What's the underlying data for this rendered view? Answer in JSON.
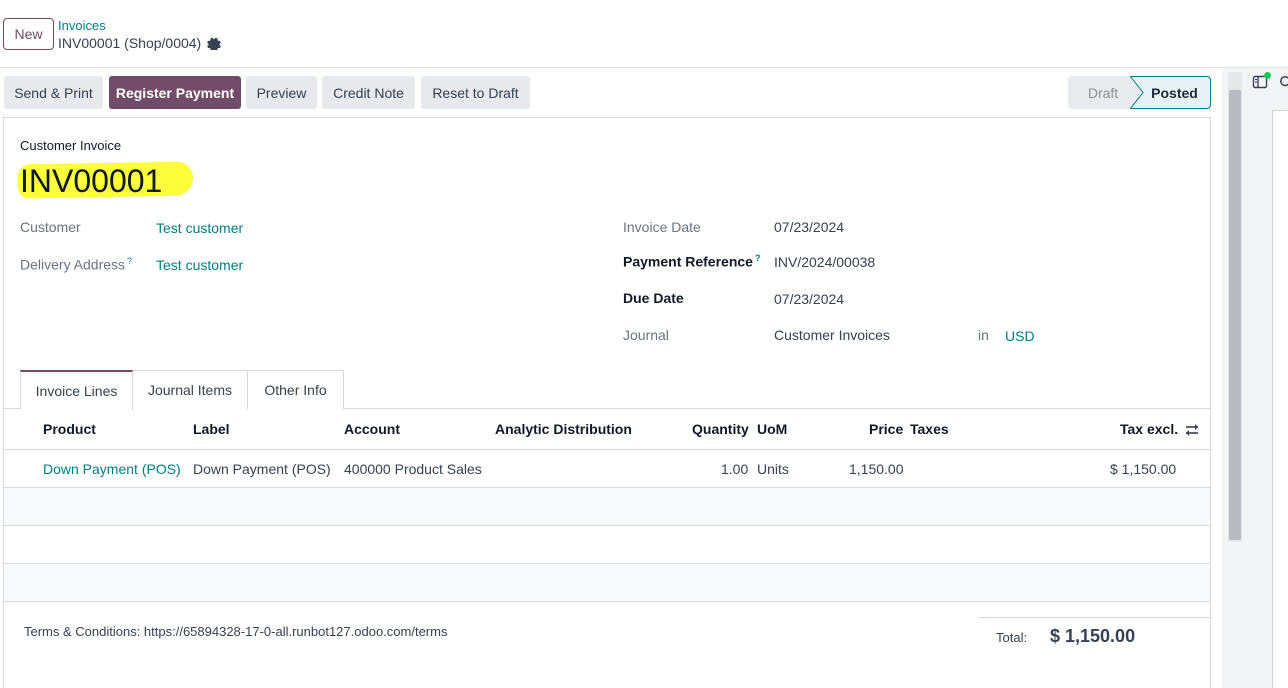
{
  "header": {
    "new_label": "New",
    "breadcrumb_parent": "Invoices",
    "breadcrumb_current": "INV00001 (Shop/0004)"
  },
  "actions": {
    "send_print": "Send & Print",
    "register_payment": "Register Payment",
    "preview": "Preview",
    "credit_note": "Credit Note",
    "reset_draft": "Reset to Draft"
  },
  "status": {
    "draft": "Draft",
    "posted": "Posted",
    "current": "Posted"
  },
  "doc": {
    "type": "Customer Invoice",
    "name": "INV00001"
  },
  "fields": {
    "customer_label": "Customer",
    "customer_value": "Test customer",
    "delivery_label": "Delivery Address",
    "delivery_value": "Test customer",
    "invoice_date_label": "Invoice Date",
    "invoice_date_value": "07/23/2024",
    "payment_ref_label": "Payment Reference",
    "payment_ref_value": "INV/2024/00038",
    "due_date_label": "Due Date",
    "due_date_value": "07/23/2024",
    "journal_label": "Journal",
    "journal_value": "Customer Invoices",
    "in_label": "in",
    "currency": "USD",
    "help_mark": "?"
  },
  "tabs": [
    "Invoice Lines",
    "Journal Items",
    "Other Info"
  ],
  "table": {
    "headers": {
      "product": "Product",
      "label": "Label",
      "account": "Account",
      "analytic": "Analytic Distribution",
      "quantity": "Quantity",
      "uom": "UoM",
      "price": "Price",
      "taxes": "Taxes",
      "tax_excl": "Tax excl."
    },
    "rows": [
      {
        "product": "Down Payment (POS)",
        "label": "Down Payment (POS)",
        "account": "400000 Product Sales",
        "analytic": "",
        "quantity": "1.00",
        "uom": "Units",
        "price": "1,150.00",
        "taxes": "",
        "tax_excl": "$ 1,150.00"
      }
    ]
  },
  "footer": {
    "terms": "Terms & Conditions: https://65894328-17-0-all.runbot127.odoo.com/terms",
    "total_label": "Total:",
    "total_value": "$ 1,150.00"
  },
  "colors": {
    "brand": "#714b67",
    "link": "#017e84",
    "highlight": "#fcff3a"
  }
}
